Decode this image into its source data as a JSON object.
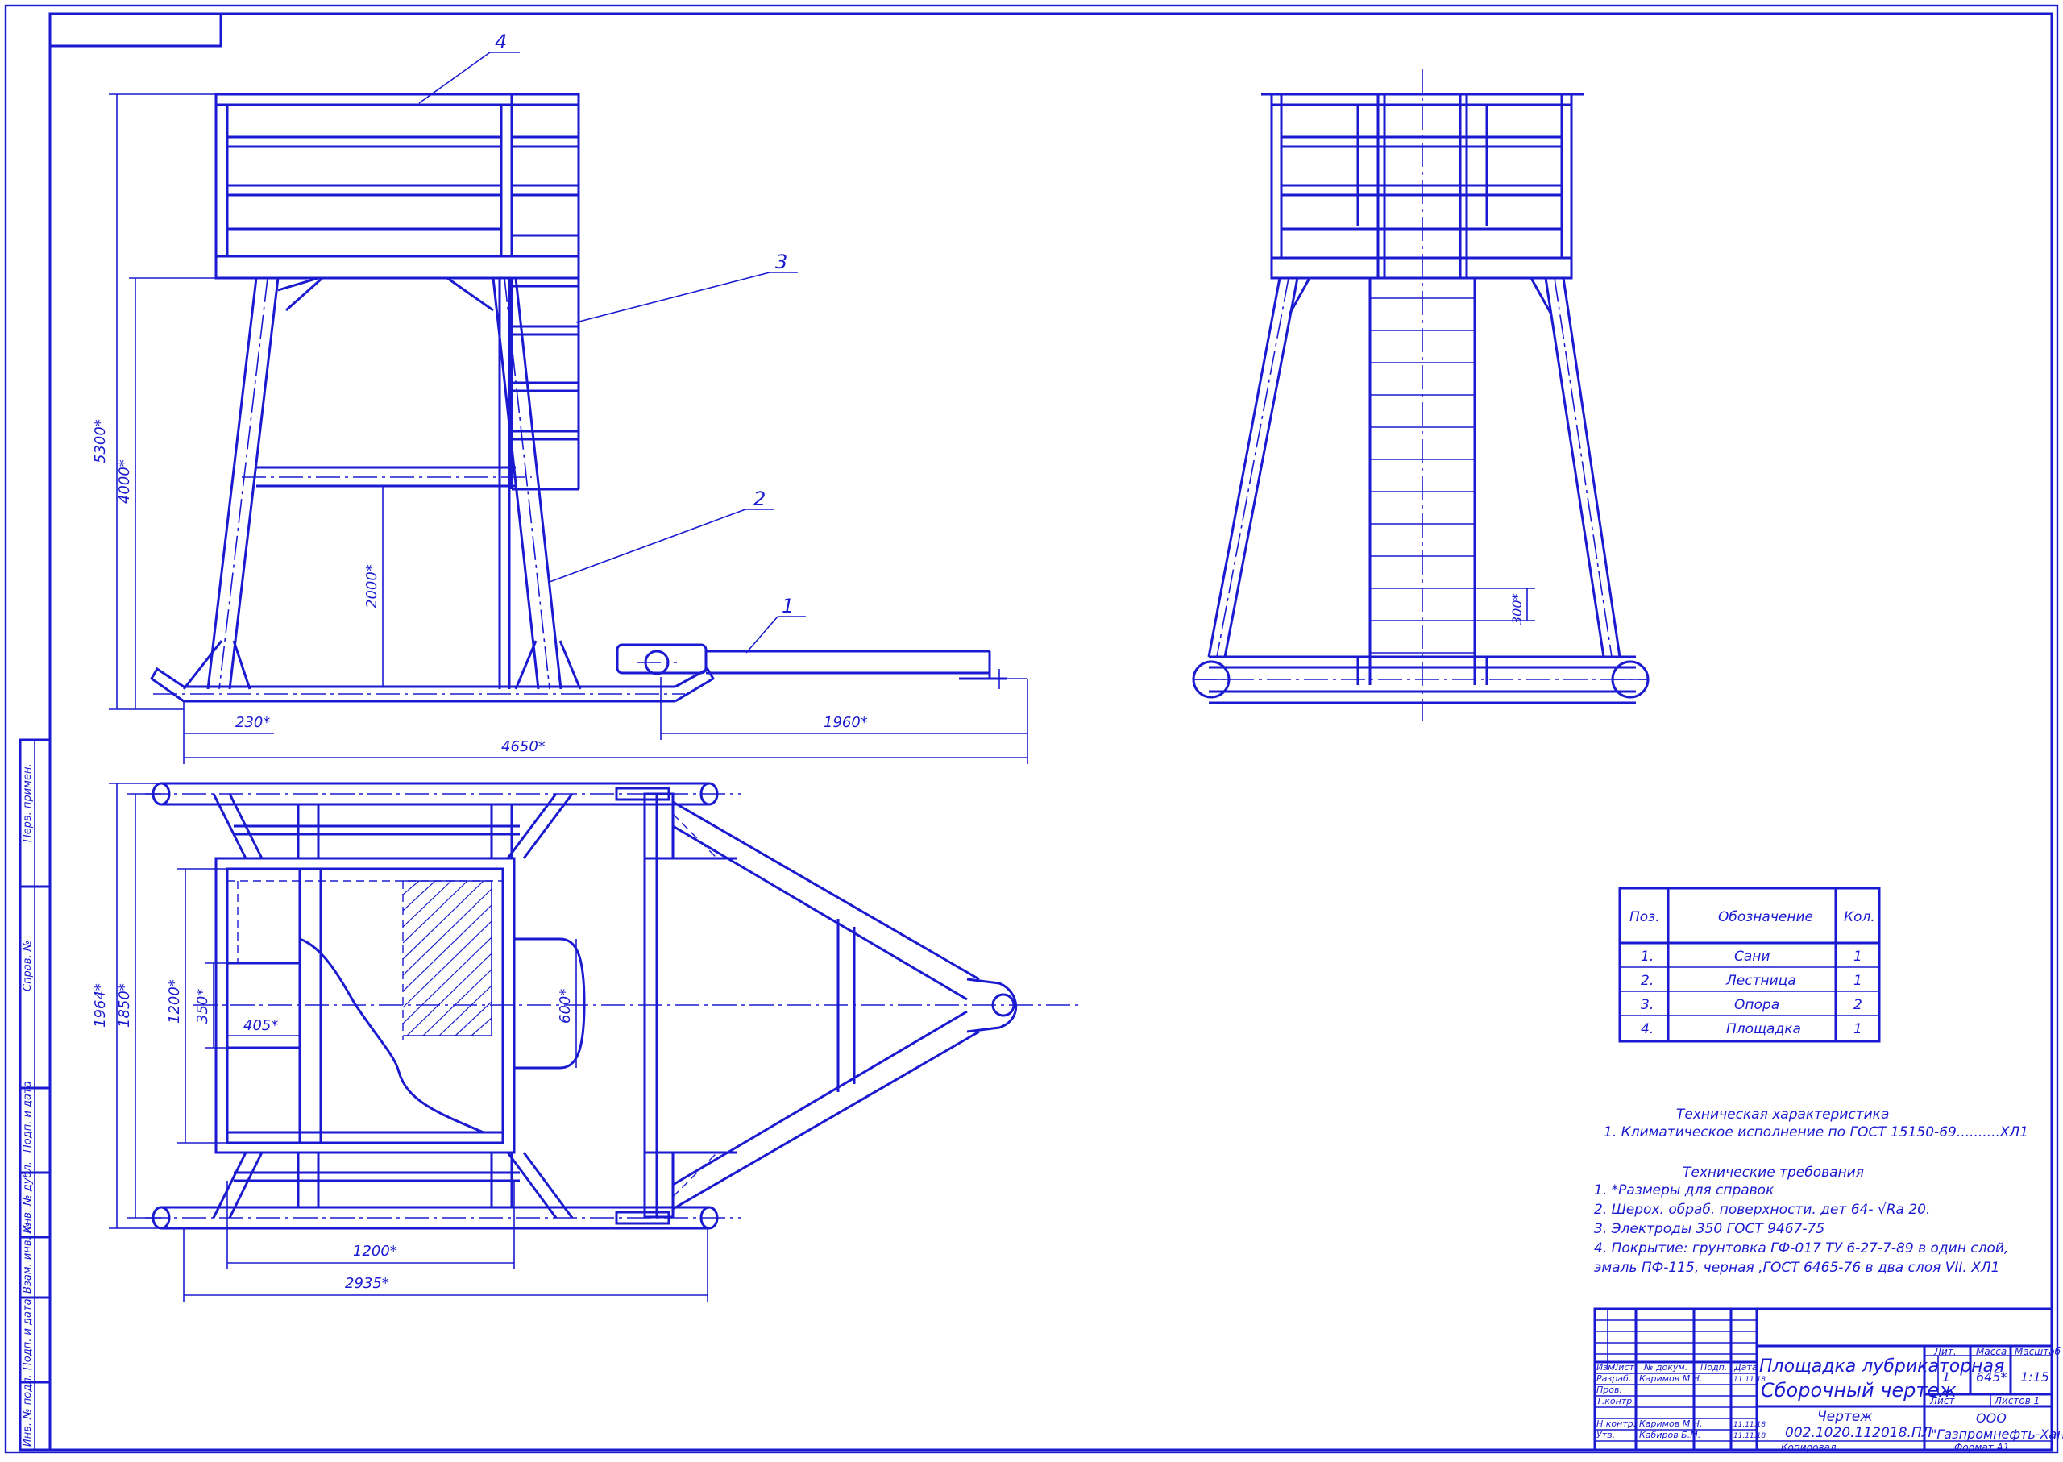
{
  "title_block": {
    "title_line1": "Площадка лубрикаторная",
    "title_line2": "Сборочный чертеж",
    "doc_type": "Чертеж",
    "doc_code": "002.1020.112018.ПЛ",
    "company_line1": "ООО",
    "company_line2": "\"Газпромнефть-Хантос\"",
    "copied": "Копировал",
    "format": "Формат   А1",
    "lit_header": "Лит.",
    "mass_header": "Масса",
    "scale_header": "Масштаб",
    "lit_value": "1",
    "mass_value": "645*",
    "scale_value": "1:15",
    "sheet_label": "Лист",
    "sheets_label": "Листов   1",
    "col_izm": "Изм.",
    "col_list": "Лист",
    "col_doc": "№ докум.",
    "col_sign": "Подп.",
    "col_date": "Дата",
    "role_dev": "Разраб.",
    "role_check": "Пров.",
    "role_tcontrol": "Т.контр.",
    "role_ncontrol": "Н.контр.",
    "role_approve": "Утв.",
    "name_dev": "Каримов М.Н.",
    "name_ncontrol": "Каримов М.Н.",
    "name_approve": "Кабиров Б.М.",
    "date_dev": "11.11.18",
    "date_ncontrol": "11.11.18",
    "date_approve": "11.11.18"
  },
  "side_stamp": [
    "Перв. примен.",
    "Справ. №",
    "Подп. и дата",
    "Инв. № дубл.",
    "Взам. инв. №",
    "Подп. и дата",
    "Инв. № подл."
  ],
  "parts_table": {
    "headers": [
      "Поз.",
      "Обозначение",
      "Кол."
    ],
    "rows": [
      [
        "1.",
        "Сани",
        "1"
      ],
      [
        "2.",
        "Лестница",
        "1"
      ],
      [
        "3.",
        "Опора",
        "2"
      ],
      [
        "4.",
        "Площадка",
        "1"
      ]
    ]
  },
  "tech_characteristic": {
    "heading": "Техническая характеристика",
    "line1": "1. Климатическое исполнение по ГОСТ 15150-69..........ХЛ1"
  },
  "tech_requirements": {
    "heading": "Технические требования",
    "lines": [
      "1. *Размеры для справок",
      "2. Шерох. обраб. поверхности. дет 64- √Ra 20.",
      "3. Электроды 350 ГОСТ 9467-75",
      "4. Покрытие: грунтовка ГФ-017 ТУ 6-27-7-89 в один слой,",
      "эмаль ПФ-115, черная ,ГОСТ  6465-76 в два слоя VII. ХЛ1"
    ]
  },
  "leaders": [
    "4",
    "3",
    "2",
    "1"
  ],
  "dimensions_front": [
    "5300*",
    "4000*",
    "2000*",
    "230*",
    "1960*",
    "4650*"
  ],
  "dimensions_side": [
    "300*"
  ],
  "dimensions_plan": [
    "1964*",
    "1850*",
    "1200*",
    "350*",
    "405*",
    "600*",
    "1200*",
    "2935*"
  ]
}
